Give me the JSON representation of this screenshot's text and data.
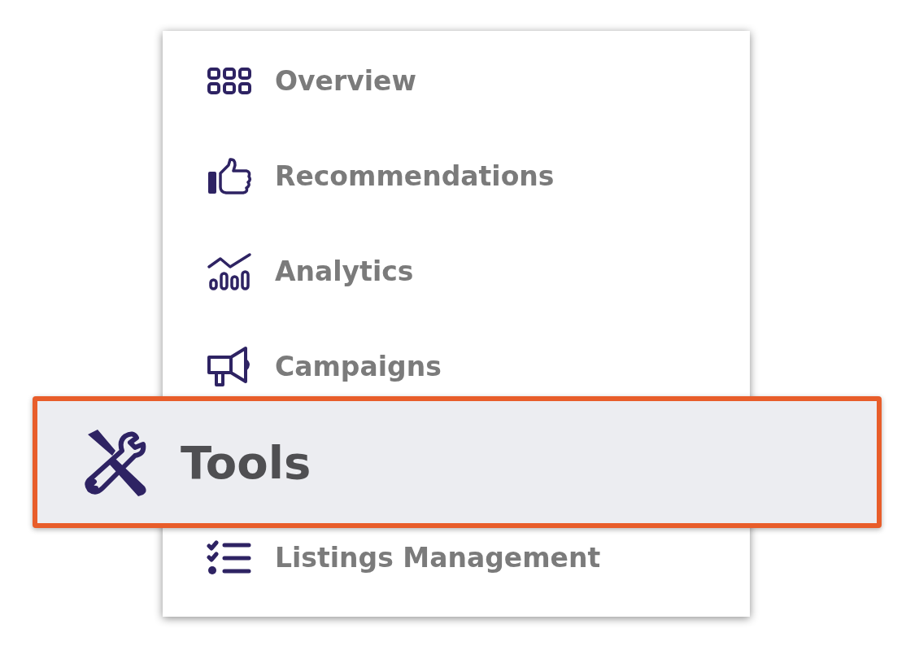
{
  "menu": {
    "items": [
      {
        "label": "Overview",
        "selected": false
      },
      {
        "label": "Recommendations",
        "selected": false
      },
      {
        "label": "Analytics",
        "selected": false
      },
      {
        "label": "Campaigns",
        "selected": false
      },
      {
        "label": "Tools",
        "selected": true
      },
      {
        "label": "Listings Management",
        "selected": false
      }
    ]
  }
}
